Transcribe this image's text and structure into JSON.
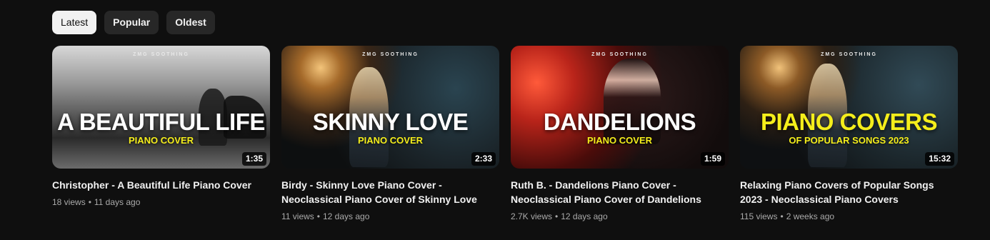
{
  "filters": {
    "chips": [
      {
        "label": "Latest",
        "active": true
      },
      {
        "label": "Popular",
        "active": false
      },
      {
        "label": "Oldest",
        "active": false
      }
    ]
  },
  "videos": [
    {
      "thumbnail": {
        "brand": "ZMG SOOTHING",
        "headline": "A BEAUTIFUL LIFE",
        "subline": "PIANO COVER"
      },
      "duration": "1:35",
      "title": "Christopher - A Beautiful Life Piano Cover",
      "views": "18 views",
      "age": "11 days ago"
    },
    {
      "thumbnail": {
        "brand": "ZMG SOOTHING",
        "headline": "SKINNY LOVE",
        "subline": "PIANO COVER"
      },
      "duration": "2:33",
      "title": "Birdy - Skinny Love Piano Cover - Neoclassical Piano Cover of Skinny Love",
      "views": "11 views",
      "age": "12 days ago"
    },
    {
      "thumbnail": {
        "brand": "ZMG SOOTHING",
        "headline": "DANDELIONS",
        "subline": "PIANO COVER"
      },
      "duration": "1:59",
      "title": "Ruth B. - Dandelions Piano Cover - Neoclassical Piano Cover of Dandelions",
      "views": "2.7K views",
      "age": "12 days ago"
    },
    {
      "thumbnail": {
        "brand": "ZMG SOOTHING",
        "headline": "PIANO COVERS",
        "subline": "OF POPULAR SONGS 2023"
      },
      "duration": "15:32",
      "title": "Relaxing Piano Covers of Popular Songs 2023 - Neoclassical Piano Covers",
      "views": "115 views",
      "age": "2 weeks ago"
    }
  ],
  "colors": {
    "background": "#0f0f0f",
    "chip_active": "#f1f1f1",
    "chip_inactive": "#272727",
    "headline_yellow": "#f5ee1b"
  }
}
